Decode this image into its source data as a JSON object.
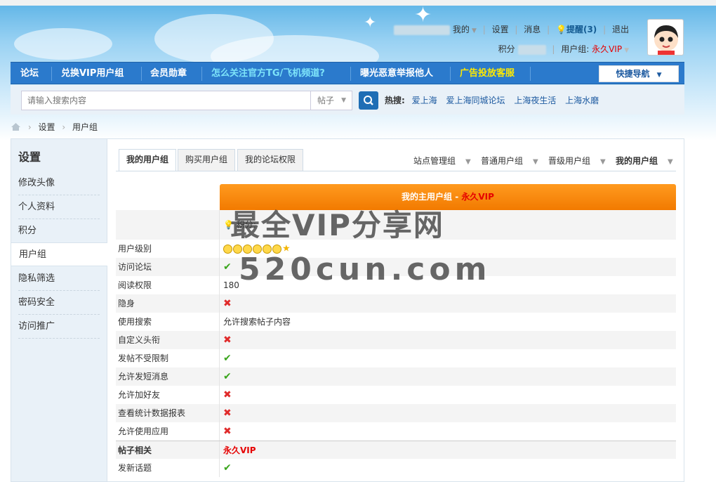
{
  "user": {
    "row1": [
      "我的",
      "设置",
      "消息",
      "提醒(3)",
      "退出"
    ],
    "points_label": "积分",
    "group_label": "用户组:",
    "group_value": "永久VIP"
  },
  "nav": {
    "items": [
      "论坛",
      "兑换VIP用户组",
      "会员勋章",
      "怎么关注官方TG/飞机频道?",
      "曝光恶意举报他人",
      "广告投放客服"
    ],
    "quick": "快捷导航"
  },
  "search": {
    "placeholder": "请输入搜索内容",
    "scope": "帖子",
    "hot_label": "热搜:",
    "hot": [
      "爱上海",
      "爱上海同城论坛",
      "上海夜生活",
      "上海水磨"
    ]
  },
  "breadcrumb": [
    "设置",
    "用户组"
  ],
  "sidebar": {
    "title": "设置",
    "items": [
      "修改头像",
      "个人资料",
      "积分",
      "用户组",
      "隐私筛选",
      "密码安全",
      "访问推广"
    ]
  },
  "tabs": [
    "我的用户组",
    "购买用户组",
    "我的论坛权限"
  ],
  "groupnav": [
    "站点管理组",
    "普通用户组",
    "晋级用户组",
    "我的用户组"
  ],
  "header": {
    "label": "我的主用户组 - ",
    "value": "永久VIP"
  },
  "points_row": "积分:",
  "rows": [
    {
      "label": "用户级别",
      "type": "level"
    },
    {
      "label": "访问论坛",
      "type": "yes"
    },
    {
      "label": "阅读权限",
      "type": "text",
      "value": "180"
    },
    {
      "label": "隐身",
      "type": "no"
    },
    {
      "label": "使用搜索",
      "type": "text",
      "value": "允许搜索帖子内容"
    },
    {
      "label": "自定义头衔",
      "type": "no"
    },
    {
      "label": "发帖不受限制",
      "type": "yes"
    },
    {
      "label": "允许发短消息",
      "type": "yes"
    },
    {
      "label": "允许加好友",
      "type": "no"
    },
    {
      "label": "查看统计数据报表",
      "type": "no"
    },
    {
      "label": "允许使用应用",
      "type": "no"
    }
  ],
  "section": {
    "label": "帖子相关",
    "value": "永久VIP"
  },
  "row_after": {
    "label": "发新话题",
    "type": "yes"
  },
  "watermark": {
    "line1": "最全VIP分享网",
    "line2": "520cun.com"
  },
  "icons": {
    "check": "check-icon",
    "cross": "cross-icon",
    "smile": "smile-icon",
    "star": "star-icon",
    "bulb": "bulb-icon",
    "home": "home-icon",
    "search": "search-icon"
  }
}
